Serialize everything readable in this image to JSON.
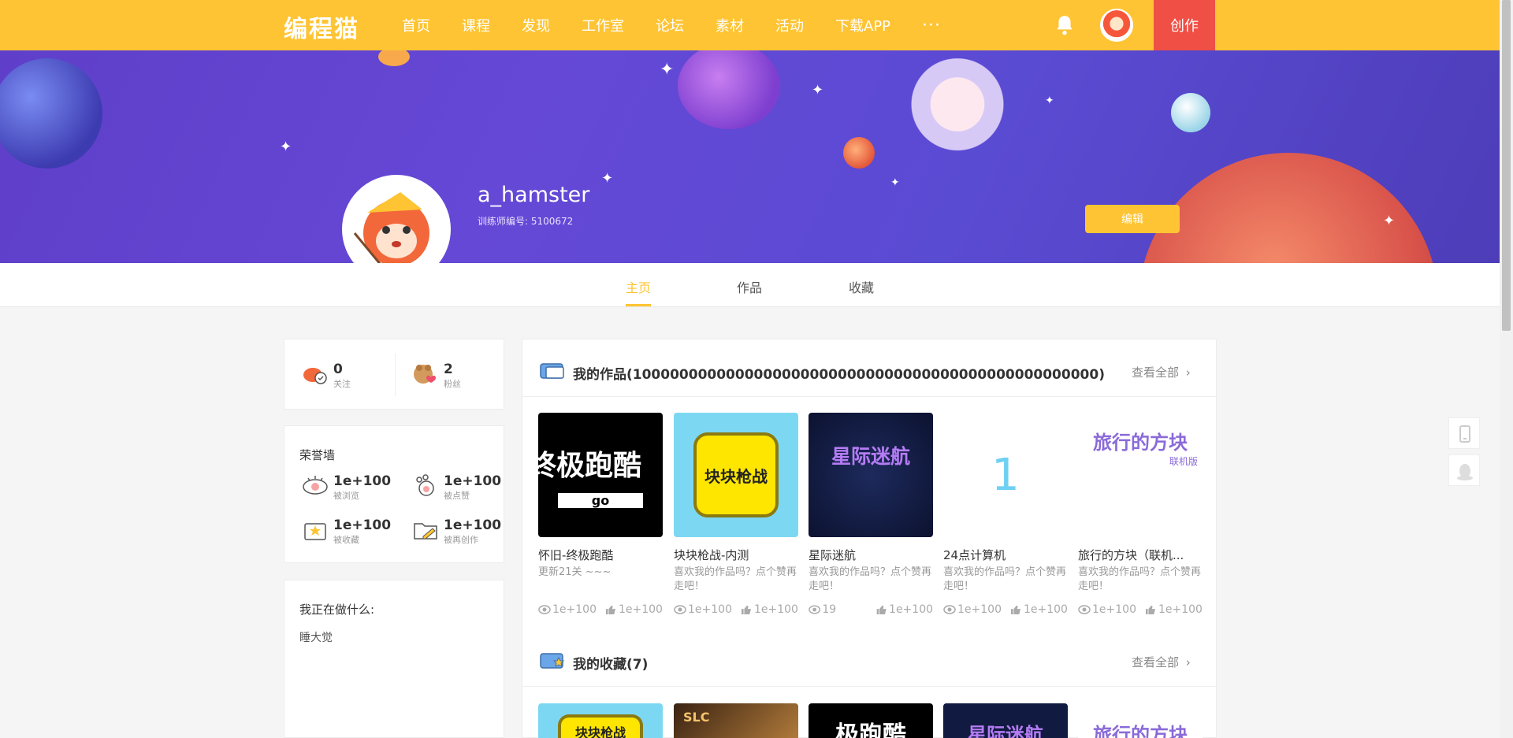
{
  "header": {
    "logo": "编程猫",
    "nav": [
      "首页",
      "课程",
      "发现",
      "工作室",
      "论坛",
      "素材",
      "活动",
      "下载APP"
    ],
    "more": "···",
    "create": "创作"
  },
  "profile": {
    "username": "a_hamster",
    "trainer_id": "训练师编号: 5100672",
    "edit": "编辑"
  },
  "tabs": [
    "主页",
    "作品",
    "收藏"
  ],
  "social": {
    "following_count": "0",
    "following_label": "关注",
    "fans_count": "2",
    "fans_label": "粉丝"
  },
  "honor": {
    "title": "荣誉墙",
    "items": [
      {
        "value": "1e+100",
        "label": "被浏览"
      },
      {
        "value": "1e+100",
        "label": "被点赞"
      },
      {
        "value": "1e+100",
        "label": "被收藏"
      },
      {
        "value": "1e+100",
        "label": "被再创作"
      }
    ]
  },
  "doing": {
    "title": "我正在做什么:",
    "text": "睡大觉"
  },
  "works": {
    "title": "我的作品(10000000000000000000000000000000000000000000000000)",
    "view_all": "查看全部",
    "items": [
      {
        "thumb_text": "终极跑酷",
        "thumb_sub": "go",
        "title": "怀旧-终极跑酷",
        "desc": "更新21关 ~~~",
        "views": "1e+100",
        "likes": "1e+100"
      },
      {
        "thumb_text": "块块枪战",
        "thumb_sub": "",
        "title": "块块枪战-内测",
        "desc": "喜欢我的作品吗？点个赞再走吧！",
        "views": "1e+100",
        "likes": "1e+100"
      },
      {
        "thumb_text": "星际迷航",
        "thumb_sub": "",
        "title": "星际迷航",
        "desc": "喜欢我的作品吗？点个赞再走吧！",
        "views": "19",
        "likes": "1e+100"
      },
      {
        "thumb_text": "1",
        "thumb_sub": "",
        "title": "24点计算机",
        "desc": "喜欢我的作品吗？点个赞再走吧！",
        "views": "1e+100",
        "likes": "1e+100"
      },
      {
        "thumb_text": "旅行的方块",
        "thumb_sub": "联机版",
        "title": "旅行的方块（联机...",
        "desc": "喜欢我的作品吗？点个赞再走吧！",
        "views": "1e+100",
        "likes": "1e+100"
      }
    ]
  },
  "favorites": {
    "title": "我的收藏(7)",
    "view_all": "查看全部",
    "thumbs": [
      "块块枪战",
      "SLC",
      "极跑酷",
      "星际迷航",
      "旅行的方块"
    ]
  },
  "colors": {
    "brand": "#fec433",
    "create": "#ef4f45",
    "banner": "#6548d6"
  }
}
